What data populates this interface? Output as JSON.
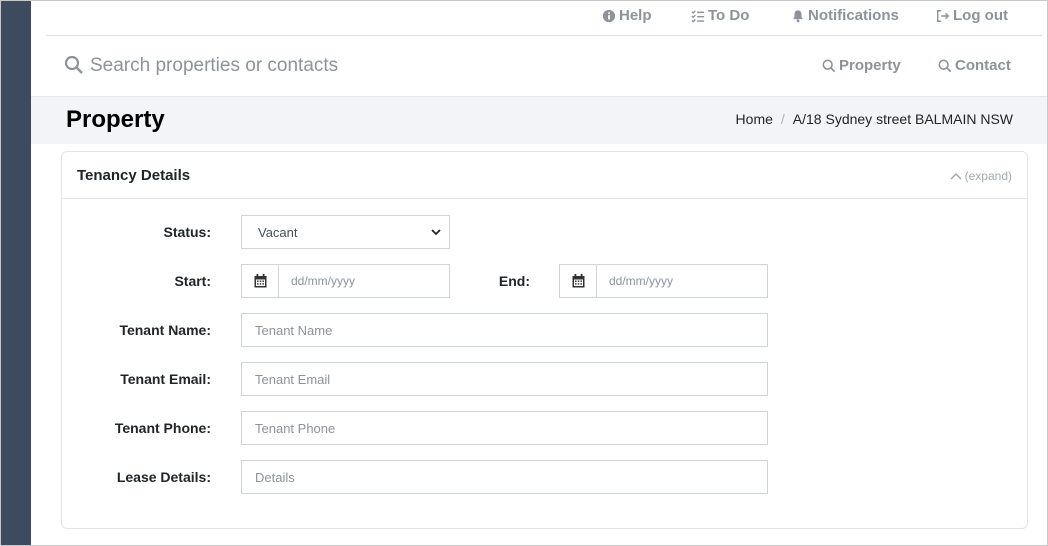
{
  "top_nav": {
    "help": "Help",
    "todo": "To Do",
    "notifications": "Notifications",
    "logout": "Log out"
  },
  "search": {
    "placeholder": "Search properties or contacts",
    "property_button": "Property",
    "contact_button": "Contact"
  },
  "page": {
    "title": "Property",
    "breadcrumb": [
      "Home",
      "A/18 Sydney street BALMAIN NSW"
    ]
  },
  "card": {
    "title": "Tenancy Details",
    "expand_label": "(expand)"
  },
  "form": {
    "status_label": "Status:",
    "status_value": "Vacant",
    "start_label": "Start:",
    "start_placeholder": "dd/mm/yyyy",
    "end_label": "End:",
    "end_placeholder": "dd/mm/yyyy",
    "tenant_name_label": "Tenant Name:",
    "tenant_name_placeholder": "Tenant Name",
    "tenant_email_label": "Tenant Email:",
    "tenant_email_placeholder": "Tenant Email",
    "tenant_phone_label": "Tenant Phone:",
    "tenant_phone_placeholder": "Tenant Phone",
    "lease_details_label": "Lease Details:",
    "lease_details_placeholder": "Details"
  },
  "colors": {
    "sidebar": "#3e4a5e",
    "muted_link": "#8c939b",
    "header_bg": "#f2f4f7"
  }
}
